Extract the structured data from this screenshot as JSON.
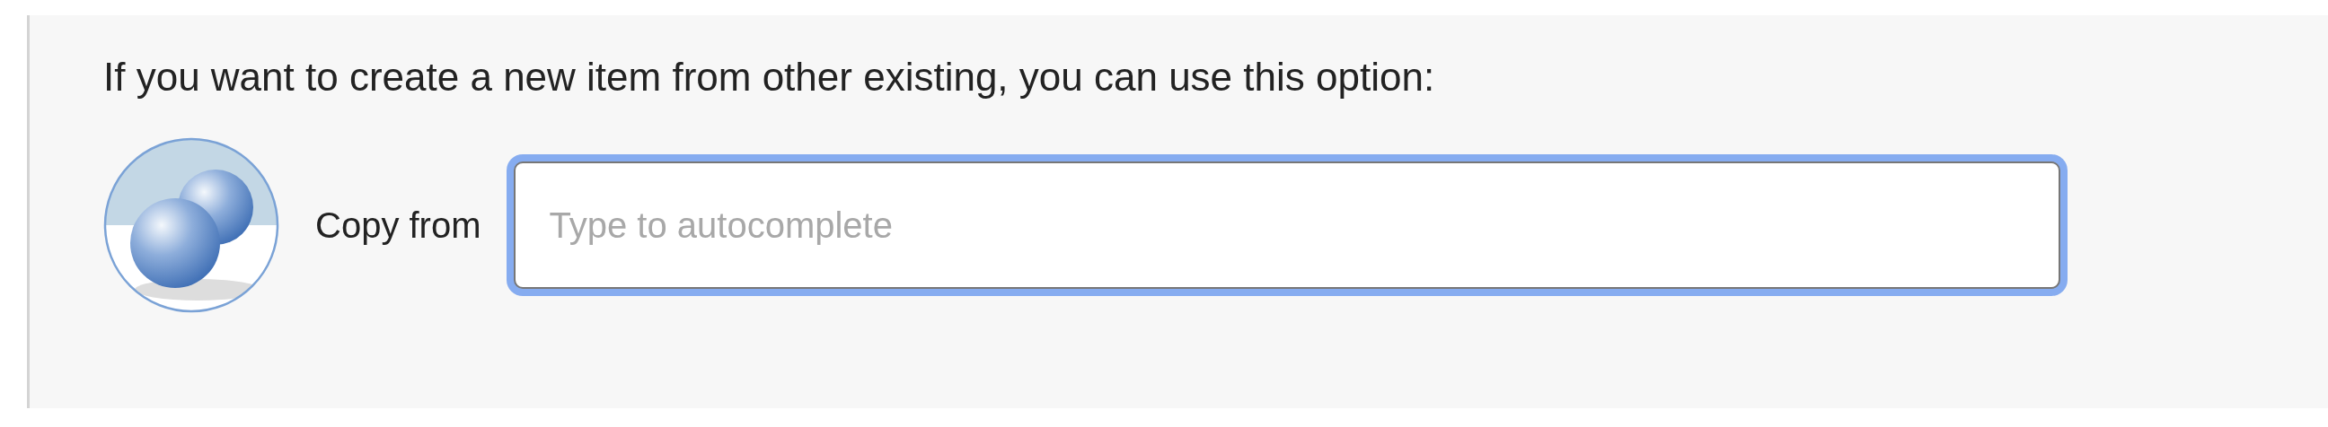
{
  "intro": "If you want to create a new item from other existing, you can use this option:",
  "copy_from": {
    "label": "Copy from",
    "placeholder": "Type to autocomplete",
    "focused": true
  }
}
